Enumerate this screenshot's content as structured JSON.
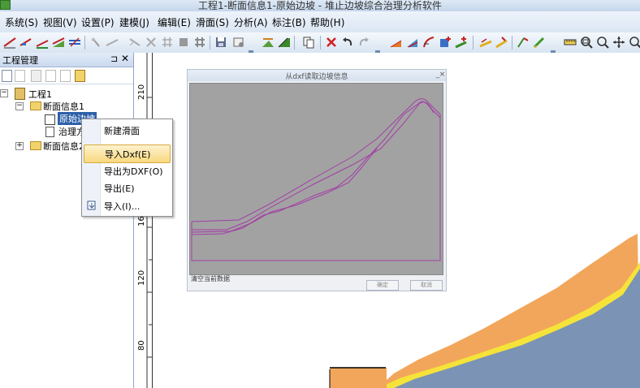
{
  "window": {
    "title": "工程1-断面信息1-原始边坡 - 堆止边坡综合治理分析软件"
  },
  "menu": [
    "系统(S)",
    "视图(V)",
    "设置(P)",
    "建模(J)",
    "编辑(E)",
    "滑面(S)",
    "分析(A)",
    "标注(B)",
    "帮助(H)"
  ],
  "panel": {
    "title": "工程管理",
    "pin": "⊐",
    "close": "✕"
  },
  "tree": {
    "root": "工程1",
    "section1": "断面信息1",
    "child_selected": "原始边坡",
    "child2": "治理方",
    "section2": "断面信息2"
  },
  "context_menu": {
    "items": [
      "新建滑面",
      "导入Dxf(E)",
      "导出为DXF(O)",
      "导出(E)",
      "导入(I)..."
    ]
  },
  "ruler": {
    "ticks": [
      "210",
      "160",
      "120",
      "80"
    ]
  },
  "dialog": {
    "title": "从dxf读取边坡信息",
    "min": "_",
    "close": "×",
    "checkbox": "清空当前数据",
    "ok": "确定",
    "cancel": "取消"
  },
  "colors": {
    "slope_orange": "#f2a65b",
    "slope_yellow": "#f5e33a",
    "slope_blue": "#7b93b4",
    "dialog_line": "#a23ea6"
  }
}
